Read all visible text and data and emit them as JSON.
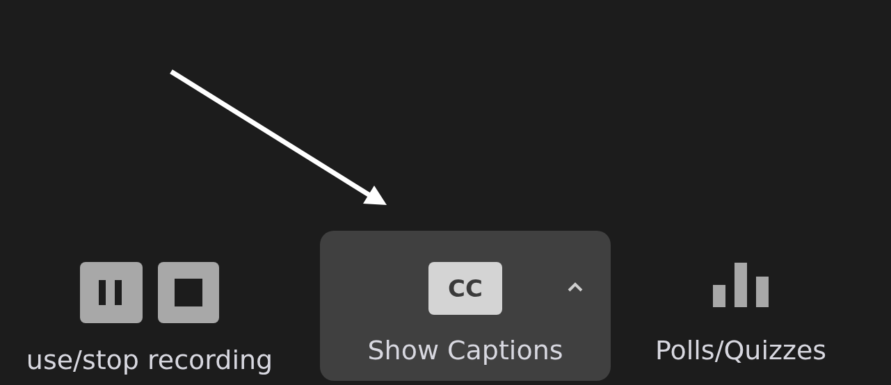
{
  "toolbar": {
    "items": [
      {
        "kind": "recording",
        "label": "use/stop recording",
        "selected": false
      },
      {
        "kind": "captions",
        "label": "Show Captions",
        "icon_text": "CC",
        "selected": true
      },
      {
        "kind": "polls",
        "label": "Polls/Quizzes",
        "selected": false
      }
    ]
  }
}
